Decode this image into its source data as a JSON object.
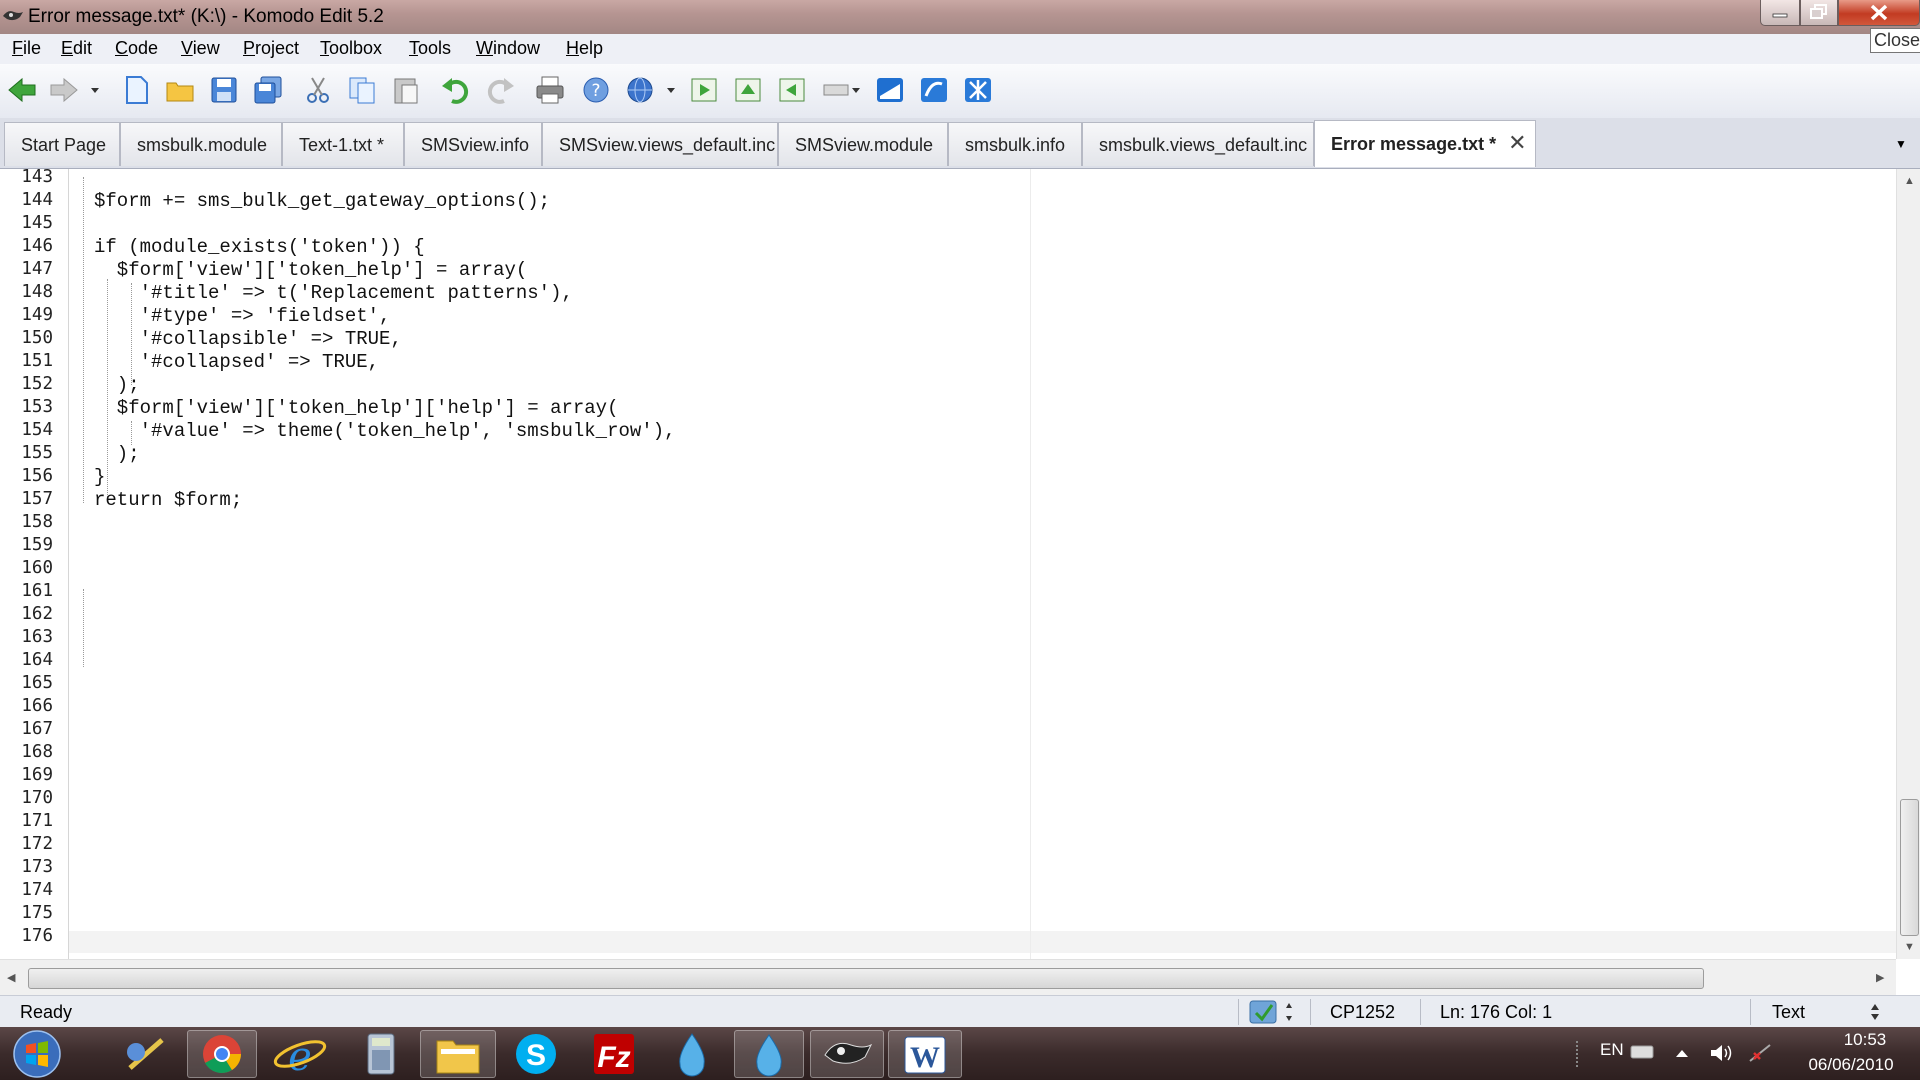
{
  "window": {
    "title": "Error message.txt* (K:\\) - Komodo Edit 5.2",
    "tooltip": "Close"
  },
  "menu": [
    "File",
    "Edit",
    "Code",
    "View",
    "Project",
    "Toolbox",
    "Tools",
    "Window",
    "Help"
  ],
  "tabs": [
    {
      "label": "Start Page"
    },
    {
      "label": "smsbulk.module"
    },
    {
      "label": "Text-1.txt  *"
    },
    {
      "label": "SMSview.info"
    },
    {
      "label": "SMSview.views_default.inc"
    },
    {
      "label": "SMSview.module"
    },
    {
      "label": "smsbulk.info"
    },
    {
      "label": "smsbulk.views_default.inc"
    },
    {
      "label": "Error message.txt  *",
      "active": true
    }
  ],
  "editor": {
    "lines": [
      {
        "n": "143",
        "text": ""
      },
      {
        "n": "144",
        "text": "$form += sms_bulk_get_gateway_options();"
      },
      {
        "n": "145",
        "text": ""
      },
      {
        "n": "146",
        "text": "if (module_exists('token')) {"
      },
      {
        "n": "147",
        "text": "  $form['view']['token_help'] = array("
      },
      {
        "n": "148",
        "text": "    '#title' => t('Replacement patterns'),"
      },
      {
        "n": "149",
        "text": "    '#type' => 'fieldset',"
      },
      {
        "n": "150",
        "text": "    '#collapsible' => TRUE,"
      },
      {
        "n": "151",
        "text": "    '#collapsed' => TRUE,"
      },
      {
        "n": "152",
        "text": "  );"
      },
      {
        "n": "153",
        "text": "  $form['view']['token_help']['help'] = array("
      },
      {
        "n": "154",
        "text": "    '#value' => theme('token_help', 'smsbulk_row'),"
      },
      {
        "n": "155",
        "text": "  );"
      },
      {
        "n": "156",
        "text": "}"
      },
      {
        "n": "157",
        "text": "return $form;"
      },
      {
        "n": "158",
        "text": ""
      },
      {
        "n": "159",
        "text": ""
      },
      {
        "n": "160",
        "text": ""
      },
      {
        "n": "161",
        "text": ""
      },
      {
        "n": "162",
        "text": ""
      },
      {
        "n": "163",
        "text": ""
      },
      {
        "n": "164",
        "text": ""
      },
      {
        "n": "165",
        "text": ""
      },
      {
        "n": "166",
        "text": ""
      },
      {
        "n": "167",
        "text": ""
      },
      {
        "n": "168",
        "text": ""
      },
      {
        "n": "169",
        "text": ""
      },
      {
        "n": "170",
        "text": ""
      },
      {
        "n": "171",
        "text": ""
      },
      {
        "n": "172",
        "text": ""
      },
      {
        "n": "173",
        "text": ""
      },
      {
        "n": "174",
        "text": ""
      },
      {
        "n": "175",
        "text": ""
      },
      {
        "n": "176",
        "text": ""
      }
    ]
  },
  "statusbar": {
    "status": "Ready",
    "encoding": "CP1252",
    "position": "Ln: 176 Col: 1",
    "language": "Text"
  },
  "taskbar": {
    "language": "EN",
    "time": "10:53",
    "date": "06/06/2010"
  },
  "colors": {
    "titlebar": "#b69592",
    "close_button": "#c23b22",
    "taskbar": "#3b2b2b"
  }
}
